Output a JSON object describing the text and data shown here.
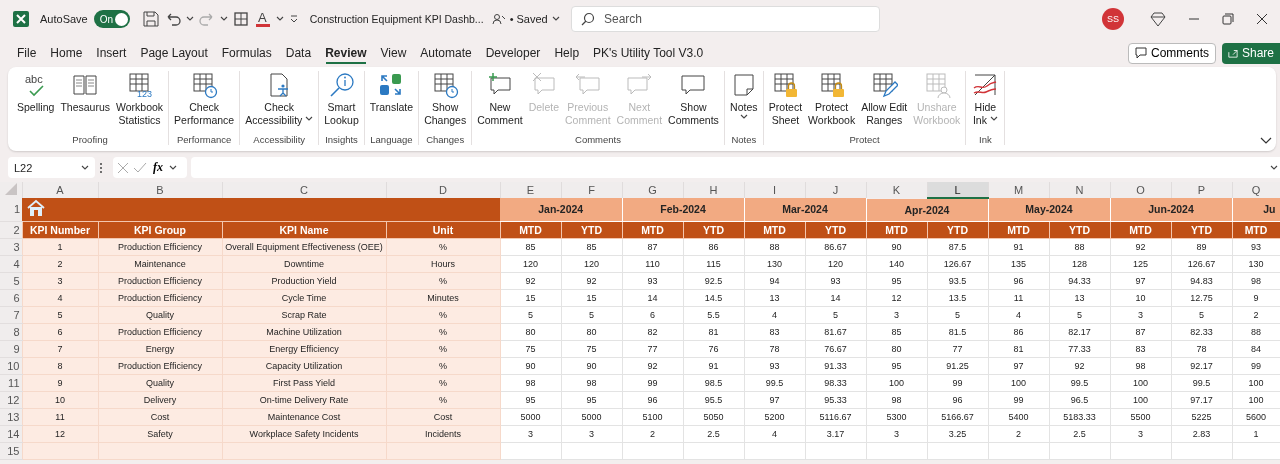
{
  "title_bar": {
    "autosave_label": "AutoSave",
    "autosave_on": true,
    "toggle_text": "On",
    "font_color_letter": "A",
    "document_title": "Construction Equipment KPI Dashb...",
    "save_status": "• Saved",
    "search_placeholder": "Search",
    "user_initials": "SS"
  },
  "menu_tabs": [
    {
      "label": "File",
      "selected": false
    },
    {
      "label": "Home",
      "selected": false
    },
    {
      "label": "Insert",
      "selected": false
    },
    {
      "label": "Page Layout",
      "selected": false
    },
    {
      "label": "Formulas",
      "selected": false
    },
    {
      "label": "Data",
      "selected": false
    },
    {
      "label": "Review",
      "selected": true
    },
    {
      "label": "View",
      "selected": false
    },
    {
      "label": "Automate",
      "selected": false
    },
    {
      "label": "Developer",
      "selected": false
    },
    {
      "label": "Help",
      "selected": false
    },
    {
      "label": "PK's Utility Tool V3.0",
      "selected": false
    }
  ],
  "comments_button": "Comments",
  "share_button": "Share",
  "ribbon": [
    {
      "label": "Proofing",
      "commands": [
        {
          "lines": [
            "Spelling"
          ],
          "kind": "spelling",
          "icon_text": "abc",
          "disabled": false
        },
        {
          "lines": [
            "Thesaurus"
          ],
          "kind": "book",
          "disabled": false
        },
        {
          "lines": [
            "Workbook",
            "Statistics"
          ],
          "kind": "stats",
          "icon_text": "123",
          "disabled": false
        }
      ]
    },
    {
      "label": "Performance",
      "commands": [
        {
          "lines": [
            "Check",
            "Performance"
          ],
          "kind": "gridclock",
          "disabled": false
        }
      ]
    },
    {
      "label": "Accessibility",
      "commands": [
        {
          "lines": [
            "Check",
            "Accessibility"
          ],
          "kind": "access",
          "dropdown": true,
          "disabled": false
        }
      ]
    },
    {
      "label": "Insights",
      "commands": [
        {
          "lines": [
            "Smart",
            "Lookup"
          ],
          "kind": "lookup",
          "disabled": false
        }
      ]
    },
    {
      "label": "Language",
      "commands": [
        {
          "lines": [
            "Translate"
          ],
          "kind": "translate",
          "disabled": false
        }
      ]
    },
    {
      "label": "Changes",
      "commands": [
        {
          "lines": [
            "Show",
            "Changes"
          ],
          "kind": "gridclock",
          "disabled": false
        }
      ]
    },
    {
      "label": "Comments",
      "commands": [
        {
          "lines": [
            "New",
            "Comment"
          ],
          "kind": "newcomment",
          "disabled": false
        },
        {
          "lines": [
            "Delete"
          ],
          "kind": "delcomment",
          "disabled": true
        },
        {
          "lines": [
            "Previous",
            "Comment"
          ],
          "kind": "prevcomment",
          "disabled": true
        },
        {
          "lines": [
            "Next",
            "Comment"
          ],
          "kind": "nextcomment",
          "disabled": true
        },
        {
          "lines": [
            "Show",
            "Comments"
          ],
          "kind": "comment",
          "disabled": false
        }
      ]
    },
    {
      "label": "Notes",
      "commands": [
        {
          "lines": [
            "Notes"
          ],
          "kind": "note",
          "dropdown": true,
          "disabled": false
        }
      ]
    },
    {
      "label": "Protect",
      "commands": [
        {
          "lines": [
            "Protect",
            "Sheet"
          ],
          "kind": "gridlock",
          "disabled": false
        },
        {
          "lines": [
            "Protect",
            "Workbook"
          ],
          "kind": "gridlock",
          "disabled": false
        },
        {
          "lines": [
            "Allow Edit",
            "Ranges"
          ],
          "kind": "gridpencil",
          "disabled": false
        },
        {
          "lines": [
            "Unshare",
            "Workbook"
          ],
          "kind": "gridperson",
          "disabled": true
        }
      ]
    },
    {
      "label": "Ink",
      "commands": [
        {
          "lines": [
            "Hide",
            "Ink"
          ],
          "kind": "ink",
          "dropdown": true,
          "disabled": false
        }
      ]
    }
  ],
  "formula_bar": {
    "name_box": "L22",
    "function_label": "fx"
  },
  "sheet": {
    "columns": [
      {
        "letter": "A",
        "selected": false
      },
      {
        "letter": "B",
        "selected": false
      },
      {
        "letter": "C",
        "selected": false
      },
      {
        "letter": "D",
        "selected": false
      },
      {
        "letter": "E",
        "selected": false
      },
      {
        "letter": "F",
        "selected": false
      },
      {
        "letter": "G",
        "selected": false
      },
      {
        "letter": "H",
        "selected": false
      },
      {
        "letter": "I",
        "selected": false
      },
      {
        "letter": "J",
        "selected": false
      },
      {
        "letter": "K",
        "selected": false
      },
      {
        "letter": "L",
        "selected": true
      },
      {
        "letter": "M",
        "selected": false
      },
      {
        "letter": "N",
        "selected": false
      },
      {
        "letter": "O",
        "selected": false
      },
      {
        "letter": "P",
        "selected": false
      },
      {
        "letter": "Q",
        "selected": false
      }
    ],
    "row_numbers": [
      "1",
      "2",
      "3",
      "4",
      "5",
      "6",
      "7",
      "8",
      "9",
      "10",
      "11",
      "12",
      "13",
      "14",
      "15"
    ],
    "months": [
      "Jan-2024",
      "Feb-2024",
      "Mar-2024",
      "Apr-2024",
      "May-2024",
      "Jun-2024",
      "Ju"
    ],
    "header": [
      "KPI Number",
      "KPI Group",
      "KPI Name",
      "Unit",
      "MTD",
      "YTD",
      "MTD",
      "YTD",
      "MTD",
      "YTD",
      "MTD",
      "YTD",
      "MTD",
      "YTD",
      "MTD",
      "YTD",
      "MTD"
    ],
    "rows": [
      [
        "1",
        "Production Efficiency",
        "Overall Equipment Effectiveness (OEE)",
        "%",
        "85",
        "85",
        "87",
        "86",
        "88",
        "86.67",
        "90",
        "87.5",
        "91",
        "88",
        "92",
        "89",
        "93"
      ],
      [
        "2",
        "Maintenance",
        "Downtime",
        "Hours",
        "120",
        "120",
        "110",
        "115",
        "130",
        "120",
        "140",
        "126.67",
        "135",
        "128",
        "125",
        "126.67",
        "130"
      ],
      [
        "3",
        "Production Efficiency",
        "Production Yield",
        "%",
        "92",
        "92",
        "93",
        "92.5",
        "94",
        "93",
        "95",
        "93.5",
        "96",
        "94.33",
        "97",
        "94.83",
        "98"
      ],
      [
        "4",
        "Production Efficiency",
        "Cycle Time",
        "Minutes",
        "15",
        "15",
        "14",
        "14.5",
        "13",
        "14",
        "12",
        "13.5",
        "11",
        "13",
        "10",
        "12.75",
        "9"
      ],
      [
        "5",
        "Quality",
        "Scrap Rate",
        "%",
        "5",
        "5",
        "6",
        "5.5",
        "4",
        "5",
        "3",
        "5",
        "4",
        "5",
        "3",
        "5",
        "2"
      ],
      [
        "6",
        "Production Efficiency",
        "Machine Utilization",
        "%",
        "80",
        "80",
        "82",
        "81",
        "83",
        "81.67",
        "85",
        "81.5",
        "86",
        "82.17",
        "87",
        "82.33",
        "88"
      ],
      [
        "7",
        "Energy",
        "Energy Efficiency",
        "%",
        "75",
        "75",
        "77",
        "76",
        "78",
        "76.67",
        "80",
        "77",
        "81",
        "77.33",
        "83",
        "78",
        "84"
      ],
      [
        "8",
        "Production Efficiency",
        "Capacity Utilization",
        "%",
        "90",
        "90",
        "92",
        "91",
        "93",
        "91.33",
        "95",
        "91.25",
        "97",
        "92",
        "98",
        "92.17",
        "99"
      ],
      [
        "9",
        "Quality",
        "First Pass Yield",
        "%",
        "98",
        "98",
        "99",
        "98.5",
        "99.5",
        "98.33",
        "100",
        "99",
        "100",
        "99.5",
        "100",
        "99.5",
        "100"
      ],
      [
        "10",
        "Delivery",
        "On-time Delivery Rate",
        "%",
        "95",
        "95",
        "96",
        "95.5",
        "97",
        "95.33",
        "98",
        "96",
        "99",
        "96.5",
        "100",
        "97.17",
        "100"
      ],
      [
        "11",
        "Cost",
        "Maintenance Cost",
        "Cost",
        "5000",
        "5000",
        "5100",
        "5050",
        "5200",
        "5116.67",
        "5300",
        "5166.67",
        "5400",
        "5183.33",
        "5500",
        "5225",
        "5600"
      ],
      [
        "12",
        "Safety",
        "Workplace Safety Incidents",
        "Incidents",
        "3",
        "3",
        "2",
        "2.5",
        "4",
        "3.17",
        "3",
        "3.25",
        "2",
        "2.5",
        "3",
        "2.83",
        "1"
      ]
    ]
  }
}
